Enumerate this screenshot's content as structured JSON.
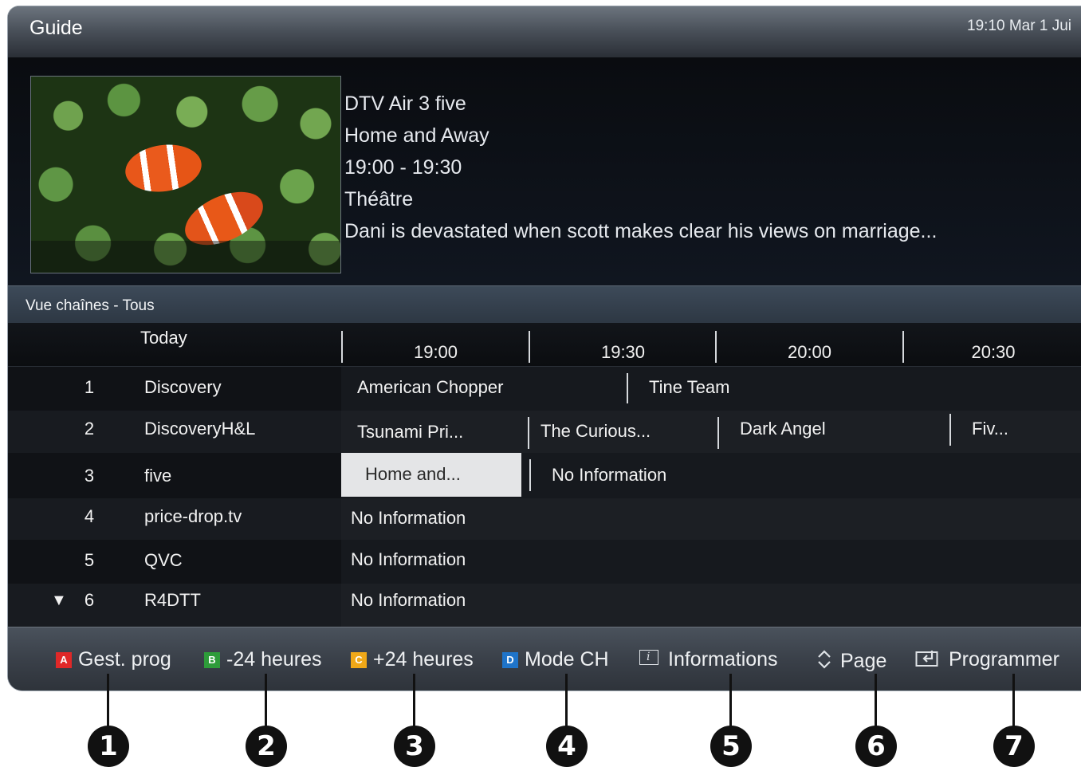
{
  "header": {
    "title": "Guide",
    "clock": "19:10 Mar 1 Jui"
  },
  "info": {
    "channel": "DTV Air 3 five",
    "program": "Home and Away",
    "time": "19:00 - 19:30",
    "genre": "Théâtre",
    "description": "Dani is devastated when scott makes clear his views on marriage..."
  },
  "view_label": "Vue chaînes - Tous",
  "grid": {
    "day": "Today",
    "times": [
      "19:00",
      "19:30",
      "20:00",
      "20:30"
    ],
    "rows": [
      {
        "number": "1",
        "name": "Discovery",
        "programs": [
          "American Chopper",
          "Tine Team"
        ]
      },
      {
        "number": "2",
        "name": "DiscoveryH&L",
        "programs": [
          "Tsunami Pri...",
          "The Curious...",
          "Dark Angel",
          "Fiv..."
        ]
      },
      {
        "number": "3",
        "name": "five",
        "programs": [
          "Home and...",
          "No Information"
        ],
        "selected_program": "Home and..."
      },
      {
        "number": "4",
        "name": "price-drop.tv",
        "programs": [
          "No Information"
        ]
      },
      {
        "number": "5",
        "name": "QVC",
        "programs": [
          "No Information"
        ]
      },
      {
        "number": "6",
        "name": "R4DTT",
        "programs": [
          "No Information"
        ],
        "marker": "▼"
      }
    ]
  },
  "footer": {
    "items": [
      {
        "key": "A",
        "label": "Gest. prog",
        "color": "#e02828"
      },
      {
        "key": "B",
        "label": "-24 heures",
        "color": "#2e9c3a"
      },
      {
        "key": "C",
        "label": "+24 heures",
        "color": "#f0a818"
      },
      {
        "key": "D",
        "label": "Mode CH",
        "color": "#1f74c9"
      },
      {
        "icon": "info-icon",
        "label": "Informations"
      },
      {
        "icon": "up-down-icon",
        "label": "Page"
      },
      {
        "icon": "enter-icon",
        "label": "Programmer"
      }
    ]
  },
  "callouts": [
    "1",
    "2",
    "3",
    "4",
    "5",
    "6",
    "7"
  ]
}
